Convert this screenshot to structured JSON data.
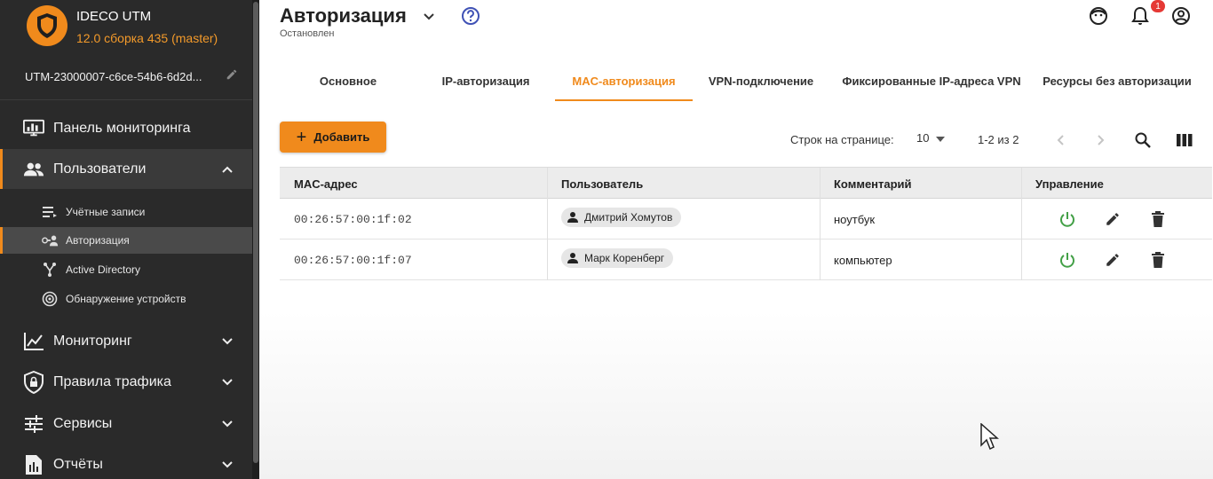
{
  "sidebar": {
    "app_name": "IDECO UTM",
    "version": "12.0 сборка 435 (master)",
    "device_name": "UTM-23000007-c6ce-54b6-6d2d...",
    "items": [
      {
        "label": "Панель мониторинга",
        "icon": "monitor-dashboard-icon"
      },
      {
        "label": "Пользователи",
        "icon": "users-icon",
        "expanded": true
      },
      {
        "label": "Мониторинг",
        "icon": "chart-line-icon"
      },
      {
        "label": "Правила трафика",
        "icon": "shield-lock-icon"
      },
      {
        "label": "Сервисы",
        "icon": "tune-icon"
      },
      {
        "label": "Отчёты",
        "icon": "report-icon"
      }
    ],
    "subitems": [
      {
        "label": "Учётные записи",
        "icon": "list-icon"
      },
      {
        "label": "Авторизация",
        "icon": "user-key-icon",
        "active": true
      },
      {
        "label": "Active Directory",
        "icon": "directory-icon"
      },
      {
        "label": "Обнаружение устройств",
        "icon": "radar-icon"
      }
    ]
  },
  "header": {
    "title": "Авторизация",
    "status": "Остановлен",
    "notification_count": "1"
  },
  "tabs": [
    {
      "label": "Основное"
    },
    {
      "label": "IP-авторизация"
    },
    {
      "label": "MAC-авторизация",
      "active": true
    },
    {
      "label": "VPN-подключение"
    },
    {
      "label": "Фиксированные IP-адреса VPN"
    },
    {
      "label": "Ресурсы без авторизации"
    }
  ],
  "toolbar": {
    "add_label": "Добавить",
    "rows_per_page_label": "Строк на странице:",
    "rows_per_page_value": "10",
    "range": "1-2 из 2"
  },
  "table": {
    "columns": [
      "MAC-адрес",
      "Пользователь",
      "Комментарий",
      "Управление"
    ],
    "rows": [
      {
        "mac": "00:26:57:00:1f:02",
        "user": "Дмитрий Хомутов",
        "comment": "ноутбук"
      },
      {
        "mac": "00:26:57:00:1f:07",
        "user": "Марк Коренберг",
        "comment": "компьютер"
      }
    ]
  },
  "colors": {
    "accent": "#f08a1c",
    "sidebar_bg": "#2a2a2a",
    "power_green": "#43a047",
    "help_blue": "#3f51b5"
  }
}
